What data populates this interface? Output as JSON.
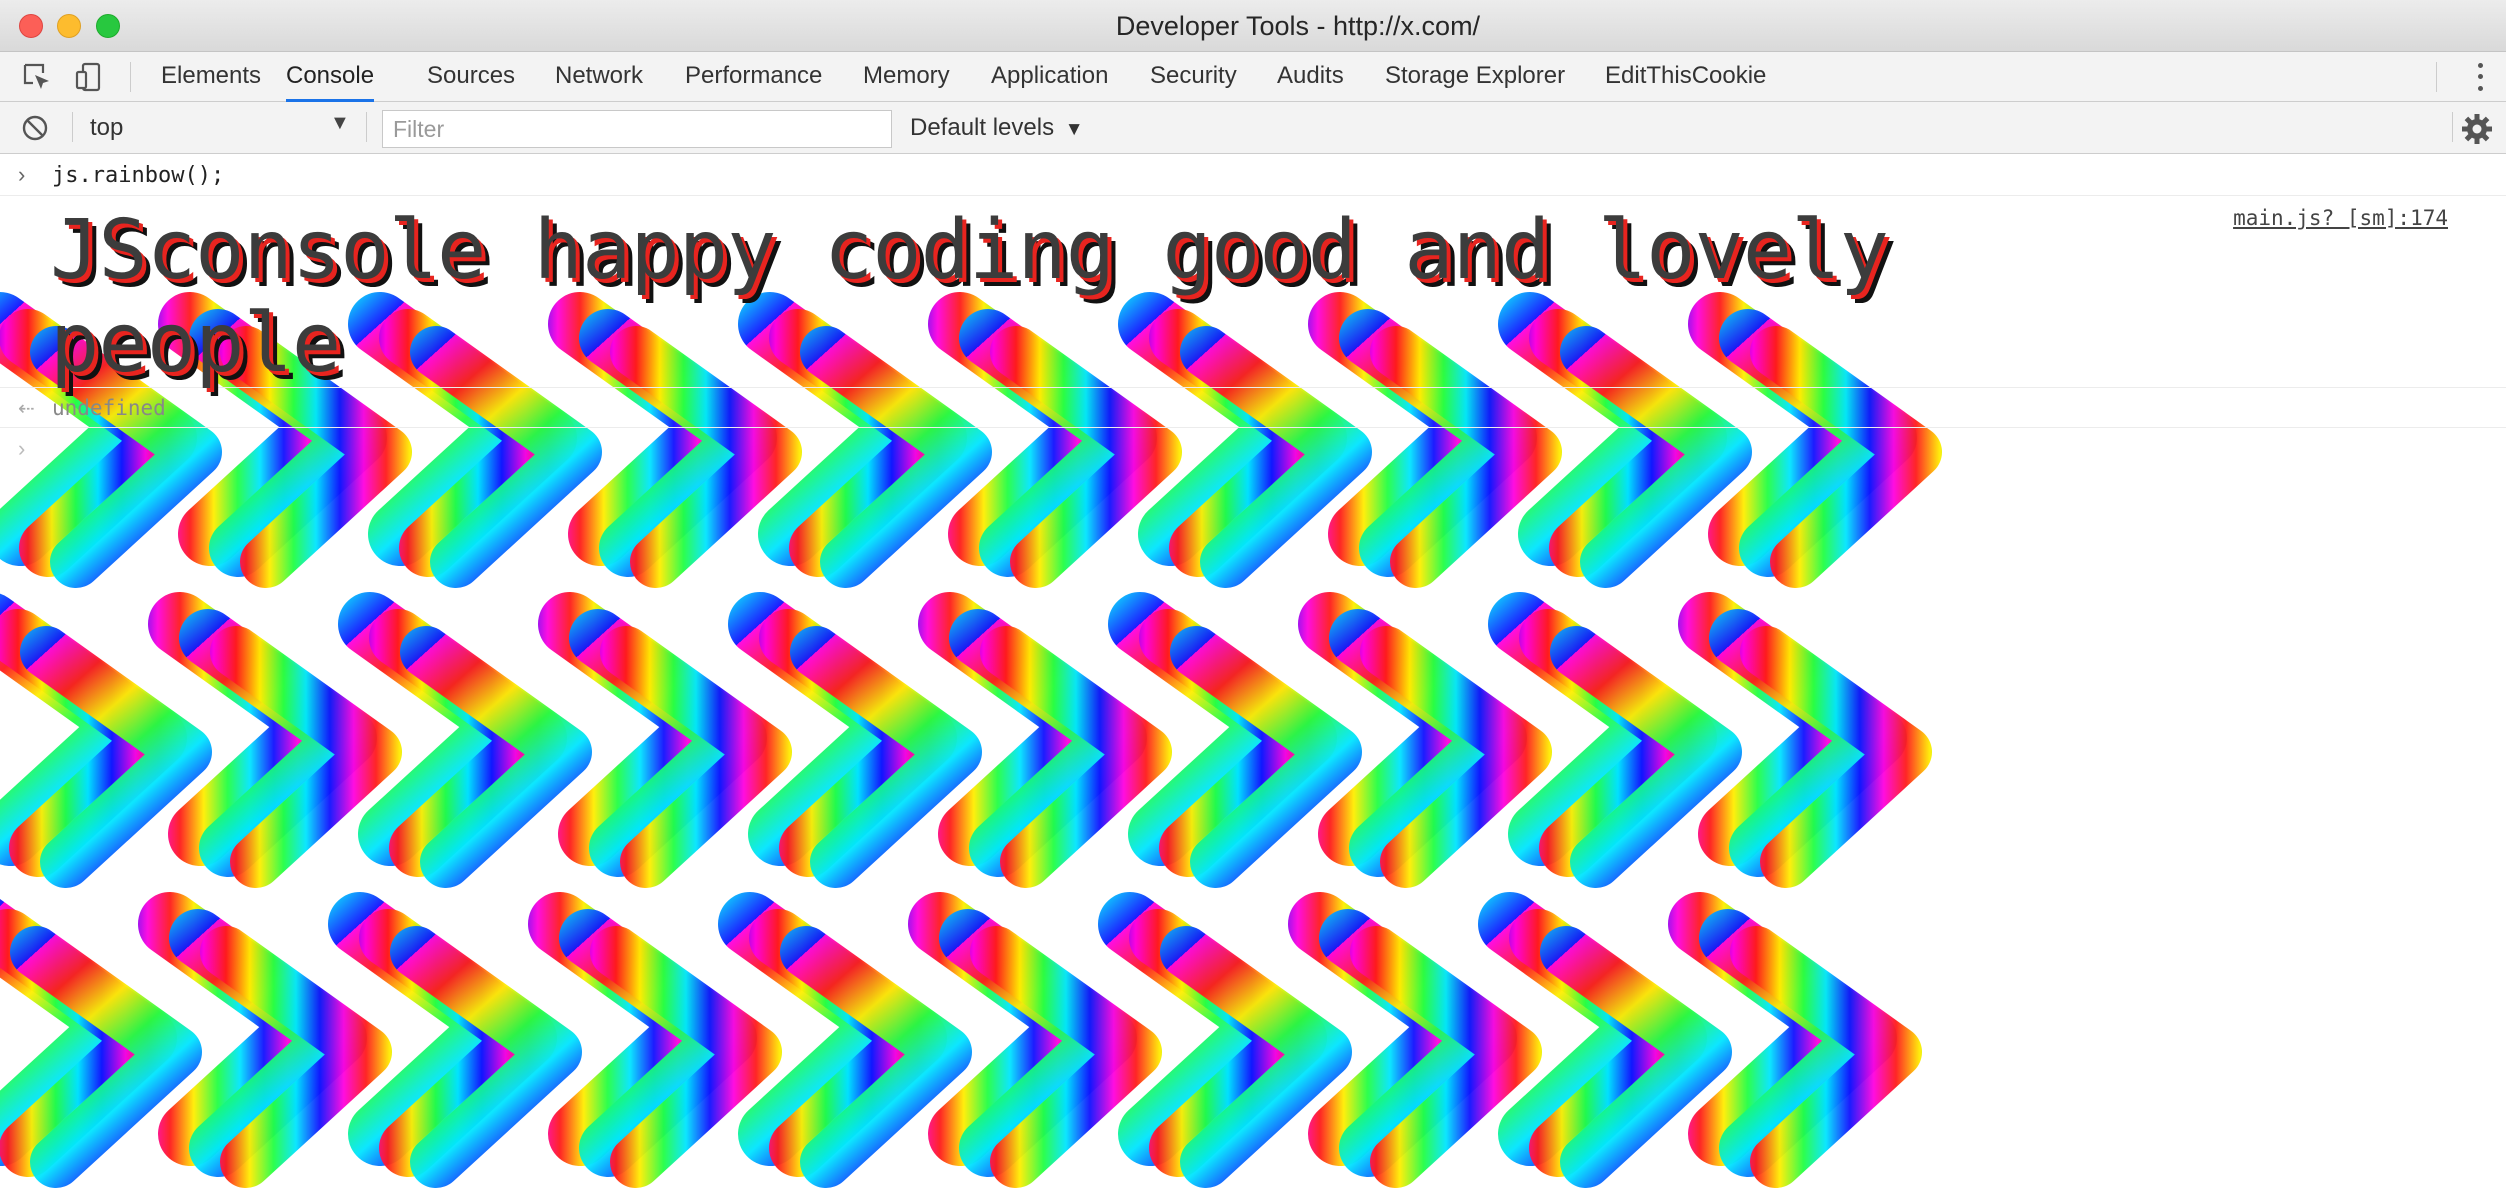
{
  "window": {
    "title": "Developer Tools - http://x.com/"
  },
  "tabs": [
    {
      "label": "Elements",
      "active": false
    },
    {
      "label": "Console",
      "active": true
    },
    {
      "label": "Sources",
      "active": false
    },
    {
      "label": "Network",
      "active": false
    },
    {
      "label": "Performance",
      "active": false
    },
    {
      "label": "Memory",
      "active": false
    },
    {
      "label": "Application",
      "active": false
    },
    {
      "label": "Security",
      "active": false
    },
    {
      "label": "Audits",
      "active": false
    },
    {
      "label": "Storage Explorer",
      "active": false
    },
    {
      "label": "EditThisCookie",
      "active": false
    }
  ],
  "toolbar": {
    "context": "top",
    "filter_placeholder": "Filter",
    "levels": "Default levels"
  },
  "console": {
    "input": "js.rainbow();",
    "log_text": "JSconsole happy coding good and lovely people",
    "log_source": "main.js? [sm]:174",
    "result": "undefined"
  },
  "colors": {
    "accent": "#1a73e8",
    "rainbow": [
      "#ff0000",
      "#ffff00",
      "#00ff00",
      "#00ffff",
      "#0000ff",
      "#ff00ff"
    ]
  }
}
